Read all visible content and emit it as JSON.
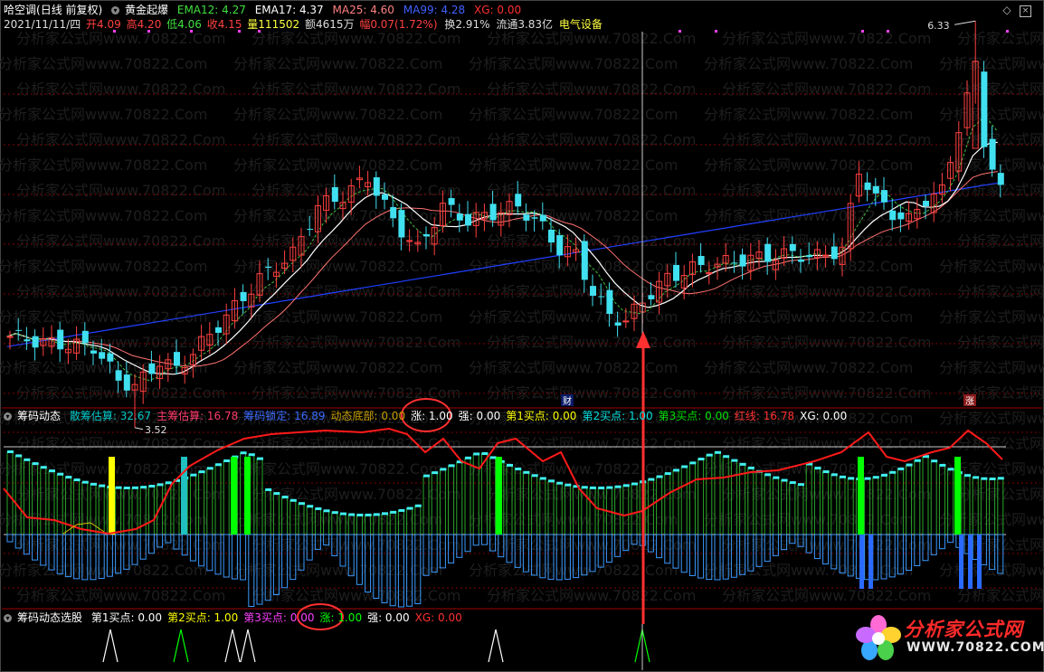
{
  "header": {
    "stock_name": "哈空调",
    "period_mode": "(日线 前复权)",
    "indicator_name": "黄金起爆",
    "ema12": "EMA12: 4.27",
    "ema17": "EMA17: 4.37",
    "ma25": "MA25: 4.60",
    "ma99": "MA99: 4.28",
    "xg": "XG: 0.00",
    "date": "2021/11/11/四",
    "open": "开4.09",
    "high": "高4.20",
    "low": "低4.06",
    "close": "收4.15",
    "volume": "量111502",
    "amount": "额4615万",
    "change": "幅0.07(1.72%)",
    "turnover": "换2.91%",
    "float": "流通3.83亿",
    "sector": "电气设备"
  },
  "price_labels": {
    "high_label": "6.33",
    "low_label": "3.52",
    "cai_marker": "财",
    "zhang_marker": "涨"
  },
  "panel2": {
    "title": "筹码动态",
    "items": [
      {
        "label": "散筹估算: 32.67",
        "color": "#00c8c8"
      },
      {
        "label": "主筹估算: 16.78",
        "color": "#ff3b6b"
      },
      {
        "label": "筹码锁定: 16.89",
        "color": "#3b6bff"
      },
      {
        "label": "动态底部: 0.00",
        "color": "#c8a000"
      },
      {
        "label": "涨: 1.00",
        "color": "#ffffff"
      },
      {
        "label": "强: 0.00",
        "color": "#ffffff"
      },
      {
        "label": "第1买点: 0.00",
        "color": "#ffff00"
      },
      {
        "label": "第2买点: 1.00",
        "color": "#00e0e0"
      },
      {
        "label": "第3买点: 0.00",
        "color": "#00e000"
      },
      {
        "label": "红线: 16.78",
        "color": "#ff3030"
      },
      {
        "label": "XG: 0.00",
        "color": "#ffffff"
      }
    ]
  },
  "panel3": {
    "title": "筹码动态选股",
    "items": [
      {
        "label": "第1买点: 0.00",
        "color": "#ffffff"
      },
      {
        "label": "第2买点: 1.00",
        "color": "#ffff00"
      },
      {
        "label": "第3买点: 0.00",
        "color": "#ff40ff"
      },
      {
        "label": "涨: 1.00",
        "color": "#00ff00"
      },
      {
        "label": "强: 0.00",
        "color": "#ffffff"
      },
      {
        "label": "XG: 0.00",
        "color": "#ff3030"
      }
    ]
  },
  "watermark": "分析家公式网www.70822.Com",
  "logo": {
    "line1": "分析家公式网",
    "line2": "WWW.70822.COM"
  },
  "window_controls": {
    "diamond": "◇",
    "close": "×"
  },
  "colors": {
    "up": "#ff4040",
    "down": "#40e0f0",
    "ma_white": "#ffffff",
    "ma_pink": "#ff7070",
    "ma_blue": "#2040ff",
    "ema_dash": "#40c040",
    "grid": "#800000",
    "annotation": "#ff3030"
  }
}
